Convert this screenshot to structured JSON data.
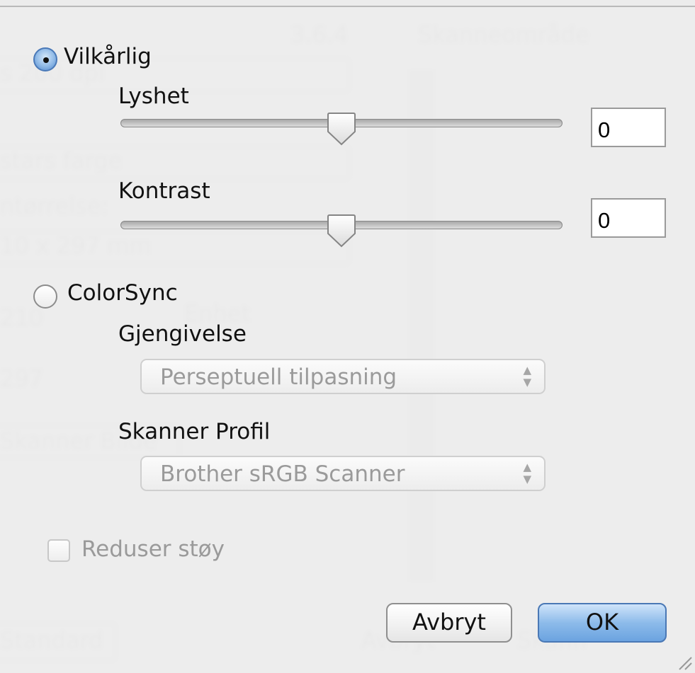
{
  "dialog": {
    "custom_radio": {
      "label": "Vilkårlig",
      "selected": true
    },
    "brightness": {
      "label": "Lyshet",
      "value": "0",
      "slider_level": 0.5
    },
    "contrast": {
      "label": "Kontrast",
      "value": "0",
      "slider_level": 0.5
    },
    "colorsync_radio": {
      "label": "ColorSync",
      "selected": false
    },
    "rendering": {
      "label": "Gjengivelse",
      "selected": "Perseptuell tilpasning"
    },
    "scanner_profile": {
      "label": "Skanner Profil",
      "selected": "Brother sRGB Scanner"
    },
    "reduce_noise": {
      "label": "Reduser støy",
      "checked": false
    },
    "buttons": {
      "cancel": "Avbryt",
      "ok": "OK"
    }
  },
  "colors": {
    "accent": "#6ba3e0",
    "disabled_text": "#9a9a9a"
  }
}
